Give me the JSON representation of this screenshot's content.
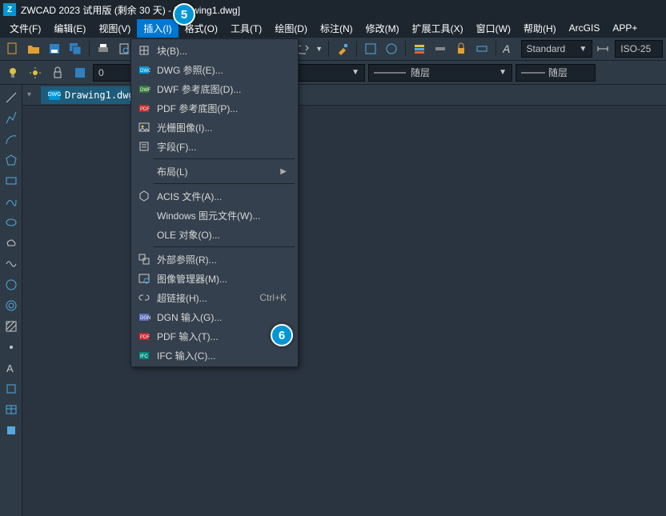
{
  "title": "ZWCAD 2023 试用版 (剩余 30 天) - [Drawing1.dwg]",
  "menubar": [
    "文件(F)",
    "编辑(E)",
    "视图(V)",
    "插入(I)",
    "格式(O)",
    "工具(T)",
    "绘图(D)",
    "标注(N)",
    "修改(M)",
    "扩展工具(X)",
    "窗口(W)",
    "帮助(H)",
    "ArcGIS",
    "APP+"
  ],
  "active_menu_index": 3,
  "layer_dropdown": "随层",
  "style_label": "Standard",
  "dimstyle_label": "ISO-25",
  "right_layer_label": "随层",
  "doc_tab": "Drawing1.dwg",
  "context_menu": {
    "items": [
      {
        "icon": "block",
        "label": "块(B)..."
      },
      {
        "icon": "dwg",
        "label": "DWG 参照(E)..."
      },
      {
        "icon": "dwf",
        "label": "DWF 参考底图(D)..."
      },
      {
        "icon": "pdf",
        "label": "PDF 参考底图(P)..."
      },
      {
        "icon": "raster",
        "label": "光栅图像(I)..."
      },
      {
        "icon": "field",
        "label": "字段(F)..."
      },
      {
        "sep": true
      },
      {
        "icon": "",
        "label": "布局(L)",
        "submenu": true
      },
      {
        "sep": true
      },
      {
        "icon": "acis",
        "label": "ACIS 文件(A)..."
      },
      {
        "icon": "",
        "label": "Windows 图元文件(W)..."
      },
      {
        "icon": "",
        "label": "OLE 对象(O)..."
      },
      {
        "sep": true
      },
      {
        "icon": "xref",
        "label": "外部参照(R)..."
      },
      {
        "icon": "imgmgr",
        "label": "图像管理器(M)..."
      },
      {
        "icon": "link",
        "label": "超链接(H)...",
        "shortcut": "Ctrl+K"
      },
      {
        "icon": "dgn",
        "label": "DGN 输入(G)..."
      },
      {
        "icon": "pdfin",
        "label": "PDF 输入(T)..."
      },
      {
        "icon": "ifc",
        "label": "IFC 输入(C)..."
      }
    ],
    "highlighted_index": 17
  },
  "callouts": {
    "menu": "5",
    "pdf": "6"
  }
}
